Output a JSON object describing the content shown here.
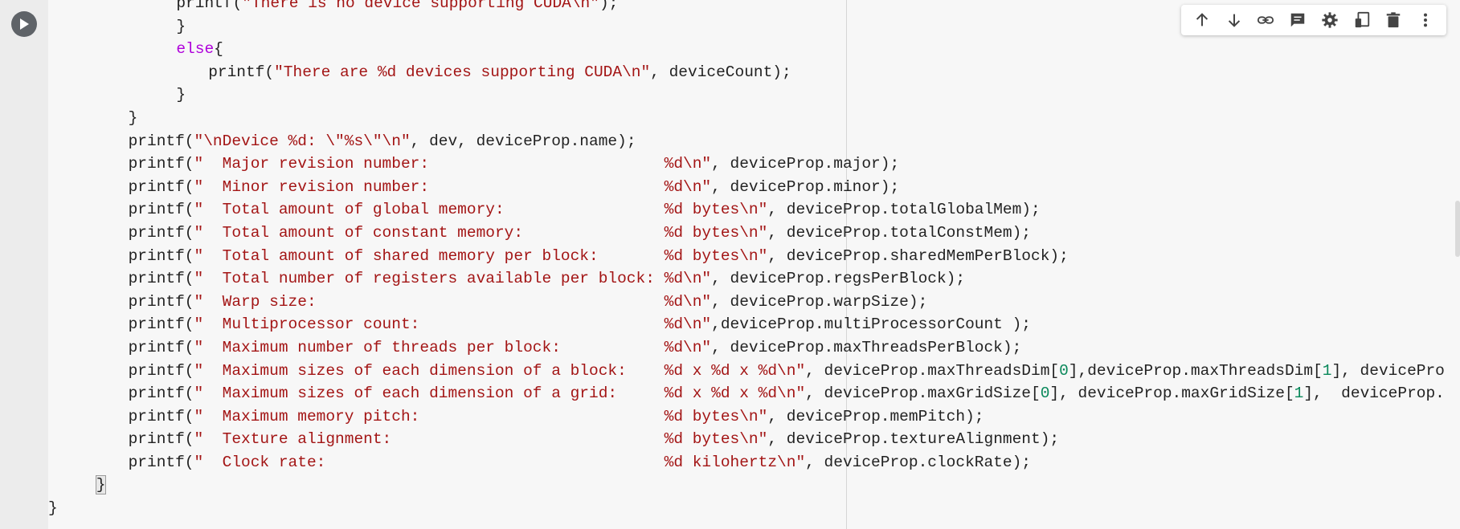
{
  "cell": {
    "run_button_icon": "play-icon"
  },
  "toolbar": {
    "buttons": [
      {
        "name": "move-up-button",
        "icon": "arrow-up-icon",
        "tooltip": ""
      },
      {
        "name": "move-down-button",
        "icon": "arrow-down-icon",
        "tooltip": ""
      },
      {
        "name": "link-button",
        "icon": "link-icon",
        "tooltip": ""
      },
      {
        "name": "comment-button",
        "icon": "comment-icon",
        "tooltip": ""
      },
      {
        "name": "settings-button",
        "icon": "gear-icon",
        "tooltip": ""
      },
      {
        "name": "mirror-button",
        "icon": "mirror-cell-icon",
        "tooltip": ""
      },
      {
        "name": "delete-button",
        "icon": "trash-icon",
        "tooltip": ""
      },
      {
        "name": "more-button",
        "icon": "more-vert-icon",
        "tooltip": ""
      }
    ]
  },
  "colors": {
    "keyword": "#af00db",
    "string": "#a31515",
    "number": "#09885a",
    "text": "#222222",
    "gutter": "#ececec",
    "editor_bg": "#f7f7f7"
  },
  "code_lines": [
    {
      "indent": 16,
      "tokens": [
        {
          "t": "str",
          "v": ""
        },
        {
          "t": "plain",
          "v": "printf("
        },
        {
          "t": "str",
          "v": "\"There is no device supporting CUDA\\n\""
        },
        {
          "t": "plain",
          "v": ");"
        }
      ]
    },
    {
      "indent": 16,
      "tokens": [
        {
          "t": "plain",
          "v": "}"
        }
      ]
    },
    {
      "indent": 16,
      "tokens": [
        {
          "t": "kw",
          "v": "else"
        },
        {
          "t": "plain",
          "v": "{"
        }
      ]
    },
    {
      "indent": 20,
      "tokens": [
        {
          "t": "plain",
          "v": "printf("
        },
        {
          "t": "str",
          "v": "\"There are %d devices supporting CUDA\\n\""
        },
        {
          "t": "plain",
          "v": ", deviceCount);"
        }
      ]
    },
    {
      "indent": 16,
      "tokens": [
        {
          "t": "plain",
          "v": "}"
        }
      ]
    },
    {
      "indent": 10,
      "tokens": [
        {
          "t": "plain",
          "v": "}"
        }
      ]
    },
    {
      "indent": 10,
      "tokens": [
        {
          "t": "plain",
          "v": "printf("
        },
        {
          "t": "str",
          "v": "\"\\nDevice %d: \\\"%s\\\"\\n\""
        },
        {
          "t": "plain",
          "v": ", dev, deviceProp.name);"
        }
      ]
    },
    {
      "indent": 10,
      "tokens": [
        {
          "t": "plain",
          "v": "printf("
        },
        {
          "t": "str",
          "v": "\"  Major revision number:                         %d\\n\""
        },
        {
          "t": "plain",
          "v": ", deviceProp.major);"
        }
      ]
    },
    {
      "indent": 10,
      "tokens": [
        {
          "t": "plain",
          "v": "printf("
        },
        {
          "t": "str",
          "v": "\"  Minor revision number:                         %d\\n\""
        },
        {
          "t": "plain",
          "v": ", deviceProp.minor);"
        }
      ]
    },
    {
      "indent": 10,
      "tokens": [
        {
          "t": "plain",
          "v": "printf("
        },
        {
          "t": "str",
          "v": "\"  Total amount of global memory:                 %d bytes\\n\""
        },
        {
          "t": "plain",
          "v": ", deviceProp.totalGlobalMem);"
        }
      ]
    },
    {
      "indent": 10,
      "tokens": [
        {
          "t": "plain",
          "v": "printf("
        },
        {
          "t": "str",
          "v": "\"  Total amount of constant memory:               %d bytes\\n\""
        },
        {
          "t": "plain",
          "v": ", deviceProp.totalConstMem);"
        }
      ]
    },
    {
      "indent": 10,
      "tokens": [
        {
          "t": "plain",
          "v": "printf("
        },
        {
          "t": "str",
          "v": "\"  Total amount of shared memory per block:       %d bytes\\n\""
        },
        {
          "t": "plain",
          "v": ", deviceProp.sharedMemPerBlock);"
        }
      ]
    },
    {
      "indent": 10,
      "tokens": [
        {
          "t": "plain",
          "v": "printf("
        },
        {
          "t": "str",
          "v": "\"  Total number of registers available per block: %d\\n\""
        },
        {
          "t": "plain",
          "v": ", deviceProp.regsPerBlock);"
        }
      ]
    },
    {
      "indent": 10,
      "tokens": [
        {
          "t": "plain",
          "v": "printf("
        },
        {
          "t": "str",
          "v": "\"  Warp size:                                     %d\\n\""
        },
        {
          "t": "plain",
          "v": ", deviceProp.warpSize);"
        }
      ]
    },
    {
      "indent": 10,
      "tokens": [
        {
          "t": "plain",
          "v": "printf("
        },
        {
          "t": "str",
          "v": "\"  Multiprocessor count:                          %d\\n\""
        },
        {
          "t": "plain",
          "v": ",deviceProp.multiProcessorCount );"
        }
      ]
    },
    {
      "indent": 10,
      "tokens": [
        {
          "t": "plain",
          "v": "printf("
        },
        {
          "t": "str",
          "v": "\"  Maximum number of threads per block:           %d\\n\""
        },
        {
          "t": "plain",
          "v": ", deviceProp.maxThreadsPerBlock);"
        }
      ]
    },
    {
      "indent": 10,
      "tokens": [
        {
          "t": "plain",
          "v": "printf("
        },
        {
          "t": "str",
          "v": "\"  Maximum sizes of each dimension of a block:    %d x %d x %d\\n\""
        },
        {
          "t": "plain",
          "v": ", deviceProp.maxThreadsDim["
        },
        {
          "t": "num",
          "v": "0"
        },
        {
          "t": "plain",
          "v": "],deviceProp.maxThreadsDim["
        },
        {
          "t": "num",
          "v": "1"
        },
        {
          "t": "plain",
          "v": "], devicePro"
        }
      ]
    },
    {
      "indent": 10,
      "tokens": [
        {
          "t": "plain",
          "v": "printf("
        },
        {
          "t": "str",
          "v": "\"  Maximum sizes of each dimension of a grid:     %d x %d x %d\\n\""
        },
        {
          "t": "plain",
          "v": ", deviceProp.maxGridSize["
        },
        {
          "t": "num",
          "v": "0"
        },
        {
          "t": "plain",
          "v": "], deviceProp.maxGridSize["
        },
        {
          "t": "num",
          "v": "1"
        },
        {
          "t": "plain",
          "v": "],  deviceProp."
        }
      ]
    },
    {
      "indent": 10,
      "tokens": [
        {
          "t": "plain",
          "v": "printf("
        },
        {
          "t": "str",
          "v": "\"  Maximum memory pitch:                          %d bytes\\n\""
        },
        {
          "t": "plain",
          "v": ", deviceProp.memPitch);"
        }
      ]
    },
    {
      "indent": 10,
      "tokens": [
        {
          "t": "plain",
          "v": "printf("
        },
        {
          "t": "str",
          "v": "\"  Texture alignment:                             %d bytes\\n\""
        },
        {
          "t": "plain",
          "v": ", deviceProp.textureAlignment);"
        }
      ]
    },
    {
      "indent": 10,
      "tokens": [
        {
          "t": "plain",
          "v": "printf("
        },
        {
          "t": "str",
          "v": "\"  Clock rate:                                    %d kilohertz\\n\""
        },
        {
          "t": "plain",
          "v": ", deviceProp.clockRate);"
        }
      ]
    },
    {
      "indent": 6,
      "tokens": [
        {
          "t": "brace",
          "v": "}"
        }
      ]
    },
    {
      "indent": 0,
      "tokens": [
        {
          "t": "plain",
          "v": "}"
        }
      ]
    }
  ]
}
